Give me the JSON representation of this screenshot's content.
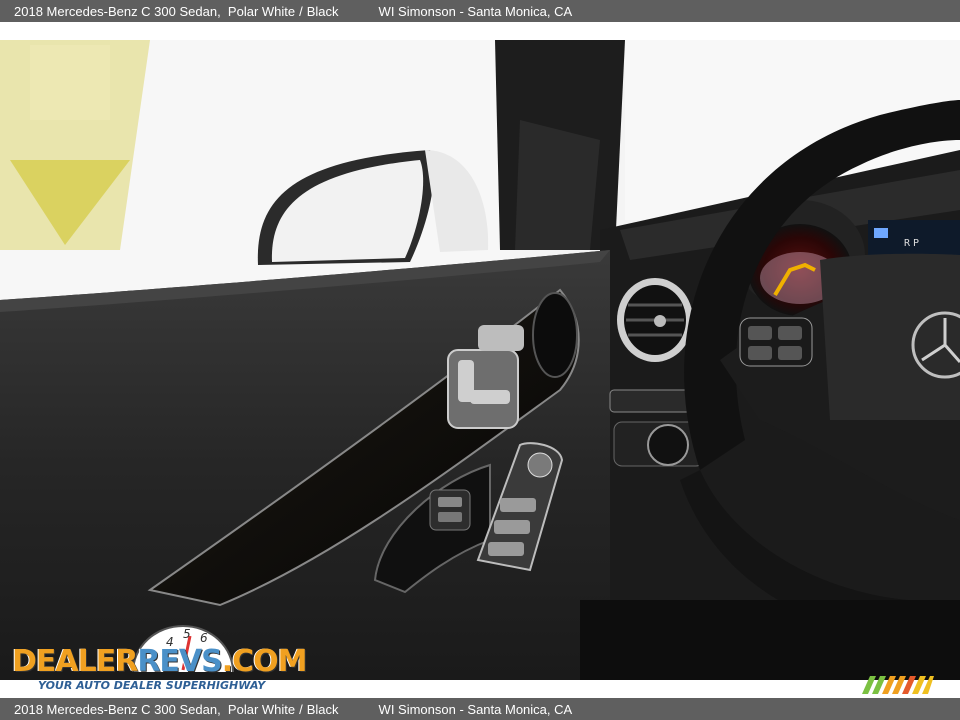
{
  "caption": {
    "vehicle": "2018 Mercedes-Benz C 300 Sedan,",
    "color": "Polar White",
    "separator": "/",
    "interior": "Black",
    "dealer": "WI Simonson - Santa Monica, CA"
  },
  "watermark": {
    "brand_part1": "DEALER",
    "brand_part2": "REVS",
    "brand_part3": ".COM",
    "tagline": "YOUR AUTO DEALER SUPERHIGHWAY"
  },
  "photo": {
    "subject": "interior-door-panel-and-steering-wheel",
    "icons": [
      "mirror-icon",
      "seat-control-icon",
      "window-switch-icon",
      "steering-wheel-icon",
      "air-vent-icon",
      "speedometer-icon",
      "mercedes-star-icon"
    ]
  },
  "colors": {
    "caption_bg": "#5f5f5f",
    "caption_text": "#ffffff",
    "brand_orange": "#f0a020",
    "brand_blue": "#4a90c8",
    "tagline_blue": "#2e5f95"
  }
}
